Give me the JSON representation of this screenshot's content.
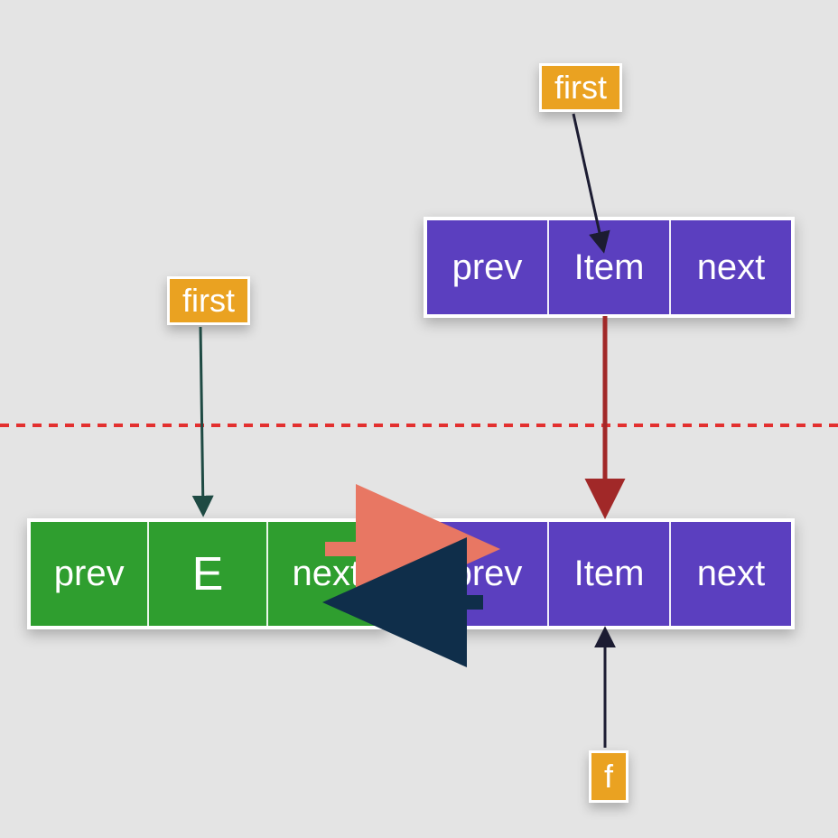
{
  "labels": {
    "first_top_right": "first",
    "first_mid_left": "first",
    "f_bottom": "f"
  },
  "nodes": {
    "topPurple": {
      "prev": "prev",
      "item": "Item",
      "next": "next"
    },
    "greenE": {
      "prev": "prev",
      "item": "E",
      "next": "next"
    },
    "bottomPurple": {
      "prev": "prev",
      "item": "Item",
      "next": "next"
    }
  },
  "colors": {
    "badge": "#eaa221",
    "purple": "#5b3fbf",
    "green": "#2f9e2f",
    "dashRed": "#e3302f",
    "arrowDarkRed": "#a12828",
    "arrowSalmon": "#e87763",
    "arrowNavy": "#0f2e4a",
    "arrowDark": "#1c1c32",
    "arrowTeal": "#1e4a43"
  }
}
